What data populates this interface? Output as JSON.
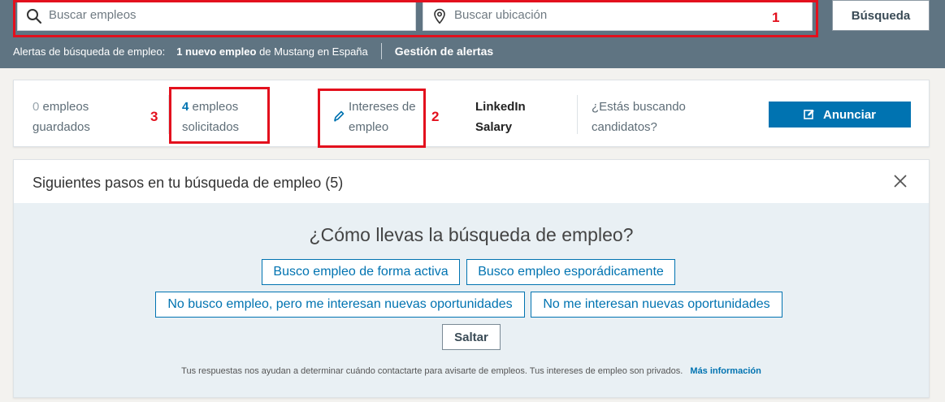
{
  "search": {
    "jobs_placeholder": "Buscar empleos",
    "location_placeholder": "Buscar ubicación",
    "button_label": "Búsqueda"
  },
  "alerts": {
    "label": "Alertas de búsqueda de empleo:",
    "new_job": "1 nuevo empleo",
    "detail": "de Mustang en España",
    "manage": "Gestión de alertas"
  },
  "stats": {
    "saved_count": "0",
    "saved_label_1": "empleos",
    "saved_label_2": "guardados",
    "applied_count": "4",
    "applied_label_1": "empleos",
    "applied_label_2": "solicitados",
    "interests_1": "Intereses de",
    "interests_2": "empleo",
    "salary_1": "LinkedIn",
    "salary_2": "Salary",
    "candidates_1": "¿Estás buscando",
    "candidates_2": "candidatos?",
    "post_button": "Anunciar"
  },
  "next_steps": {
    "title": "Siguientes pasos en tu búsqueda de empleo (5)",
    "question": "¿Cómo llevas la búsqueda de empleo?",
    "options": [
      "Busco empleo de forma activa",
      "Busco empleo esporádicamente",
      "No busco empleo, pero me interesan nuevas oportunidades",
      "No me interesan nuevas oportunidades"
    ],
    "skip": "Saltar",
    "privacy": "Tus respuestas nos ayudan a determinar cuándo contactarte para avisarte de empleos. Tus intereses de empleo son privados.",
    "more_info": "Más información"
  },
  "annotations": {
    "label_1": "1",
    "label_2": "2",
    "label_3": "3"
  },
  "colors": {
    "topbar": "#5f7482",
    "accent": "#0073b1",
    "annotation": "#e3101d"
  }
}
